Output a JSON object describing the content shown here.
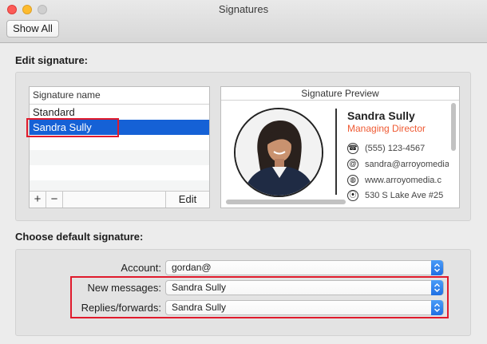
{
  "window": {
    "title": "Signatures",
    "show_all_label": "Show All"
  },
  "edit_section": {
    "title": "Edit signature:",
    "list_header": "Signature name",
    "signatures": [
      {
        "label": "Standard",
        "selected": false
      },
      {
        "label": "Sandra Sully",
        "selected": true
      }
    ],
    "add_label": "+",
    "remove_label": "−",
    "edit_label": "Edit"
  },
  "preview": {
    "header": "Signature Preview",
    "name": "Sandra Sully",
    "role": "Managing Director",
    "phone": "(555) 123-4567",
    "email": "sandra@arroyomedia",
    "website": "www.arroyomedia.c",
    "address": "530 S Lake Ave #25",
    "accent_color": "#ef5a33"
  },
  "default_section": {
    "title": "Choose default signature:",
    "account_label": "Account:",
    "account_value": "gordan@",
    "new_messages_label": "New messages:",
    "new_messages_value": "Sandra Sully",
    "replies_label": "Replies/forwards:",
    "replies_value": "Sandra Sully"
  },
  "colors": {
    "selection": "#1561d6",
    "highlight_box": "#e01a2c",
    "popup_accent": "#2a7cf0"
  }
}
